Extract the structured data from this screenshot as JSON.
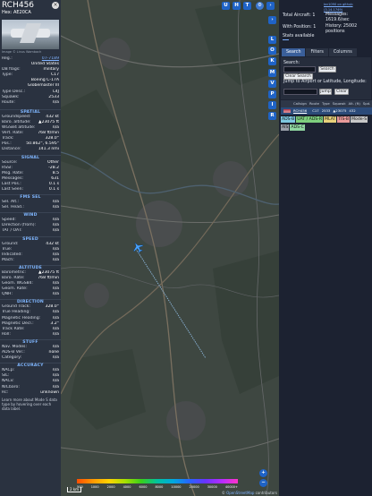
{
  "aircraft": {
    "callsign": "RCH456",
    "hex_label": "Hex: AE20CA",
    "photo_credit": "Image © Linus Wambach",
    "reg": {
      "label": "Reg.:",
      "value": "07-7189"
    },
    "country": {
      "label": "",
      "value": "United States"
    },
    "db_flags": {
      "label": "DB flags:",
      "value": "military"
    },
    "type": {
      "label": "Type:",
      "value": "C17"
    },
    "type_name_1": {
      "label": "",
      "value": "Boeing C-17A"
    },
    "type_name_2": {
      "label": "",
      "value": "Globemaster III"
    },
    "type_desc": {
      "label": "Type Desc.:",
      "value": "L4J"
    },
    "squawk": {
      "label": "Squawk:",
      "value": "2533"
    },
    "route": {
      "label": "Route:",
      "value": "n/a"
    }
  },
  "sections": {
    "spatial": {
      "title": "SPATIAL",
      "rows": [
        {
          "label": "Groundspeed:",
          "value": "432 kt"
        },
        {
          "label": "Baro. altitude:",
          "value": "▲23075 ft"
        },
        {
          "label": "WGS84 altitude:",
          "value": "n/a"
        },
        {
          "label": "Vert. Rate:",
          "value": "768 ft/min"
        },
        {
          "label": "Track:",
          "value": "328.0°"
        },
        {
          "label": "Pos.:",
          "value": "50.862°, 6.595°"
        },
        {
          "label": "Distance:",
          "value": "141.3 nmi"
        }
      ]
    },
    "signal": {
      "title": "SIGNAL",
      "rows": [
        {
          "label": "Source:",
          "value": "Other"
        },
        {
          "label": "RSSI:",
          "value": "-28.2"
        },
        {
          "label": "Msg. Rate:",
          "value": "8.5"
        },
        {
          "label": "Messages:",
          "value": "631"
        },
        {
          "label": "Last Pos.:",
          "value": "0.1 s"
        },
        {
          "label": "Last Seen:",
          "value": "0.1 s"
        }
      ]
    },
    "fms": {
      "title": "FMS SEL",
      "rows": [
        {
          "label": "Sel. Alt.:",
          "value": "n/a"
        },
        {
          "label": "Sel. Head.:",
          "value": "n/a"
        }
      ]
    },
    "wind": {
      "title": "WIND",
      "rows": [
        {
          "label": "Speed:",
          "value": "n/a"
        },
        {
          "label": "Direction (from):",
          "value": "n/a"
        },
        {
          "label": "TAT / OAT:",
          "value": "n/a"
        }
      ]
    },
    "speed": {
      "title": "SPEED",
      "rows": [
        {
          "label": "Ground:",
          "value": "432 kt"
        },
        {
          "label": "True:",
          "value": "n/a"
        },
        {
          "label": "Indicated:",
          "value": "n/a"
        },
        {
          "label": "Mach:",
          "value": "n/a"
        }
      ]
    },
    "altitude": {
      "title": "ALTITUDE",
      "rows": [
        {
          "label": "Barometric:",
          "value": "▲23075 ft"
        },
        {
          "label": "Baro. Rate:",
          "value": "768 ft/min"
        },
        {
          "label": "Geom. WGS84:",
          "value": "n/a"
        },
        {
          "label": "Geom. Rate:",
          "value": "n/a"
        },
        {
          "label": "QNH:",
          "value": "n/a"
        }
      ]
    },
    "direction": {
      "title": "DIRECTION",
      "rows": [
        {
          "label": "Ground Track:",
          "value": "328.0°"
        },
        {
          "label": "True Heading:",
          "value": "n/a"
        },
        {
          "label": "Magnetic Heading:",
          "value": "n/a"
        },
        {
          "label": "Magnetic Decl.:",
          "value": "3.2°"
        },
        {
          "label": "Track Rate:",
          "value": "n/a"
        },
        {
          "label": "Roll:",
          "value": "n/a"
        }
      ]
    },
    "stuff": {
      "title": "STUFF",
      "rows": [
        {
          "label": "Nav. Modes:",
          "value": "n/a"
        },
        {
          "label": "ADS-B Ver.:",
          "value": "none"
        },
        {
          "label": "Category:",
          "value": "n/a"
        }
      ]
    },
    "accuracy": {
      "title": "ACCURACY",
      "rows": [
        {
          "label": "NACp:",
          "value": "n/a"
        },
        {
          "label": "SIL:",
          "value": "n/a"
        },
        {
          "label": "NACv:",
          "value": "n/a"
        },
        {
          "label": "NICbaro:",
          "value": "n/a"
        },
        {
          "label": "Rc:",
          "value": "unknown"
        }
      ]
    }
  },
  "footer_text": "Learn more about Mode S data type by hovering over each data label.",
  "map": {
    "top_buttons": [
      "U",
      "H",
      "T"
    ],
    "side_buttons": [
      "L",
      "O",
      "K",
      "M",
      "V",
      "P",
      "I",
      "R"
    ],
    "scale_label": "2 km",
    "credit_prefix": "© ",
    "credit_link": "OpenStreetMap",
    "credit_suffix": " contributors",
    "colorbar_ticks": [
      "500",
      "1000",
      "2000",
      "4000",
      "6000",
      "8000",
      "10000",
      "20000",
      "30000",
      "40000+"
    ],
    "zoom_in": "+",
    "zoom_out": "−"
  },
  "right": {
    "version": "tar1090 on github (3.14.1749)",
    "total_aircraft": "Total Aircraft: 1",
    "with_position": "With Position: 1",
    "stats_available": "Stats available",
    "messages": "Messages: 1619.6/sec",
    "history": "History: 25002 positions",
    "tabs": [
      "Search",
      "Filters",
      "Columns"
    ],
    "search_label": "Search:",
    "search_button": "Search",
    "clear_search": "Clear Search",
    "jump_label": "Jump to Airport or Latitude, Longitude:",
    "jump_button": "Jump",
    "clear_button": "Clear",
    "table_headers": [
      "",
      "Callsign",
      "Route",
      "Type",
      "Squawk",
      "Alt. (ft)",
      "Spd."
    ],
    "table_row": [
      "",
      "RCH456",
      "",
      "C17",
      "2533",
      "▲23075",
      "432"
    ],
    "legend": [
      {
        "label": "ADS-B",
        "color": "#7ec8e0"
      },
      {
        "label": "UAT / ADS-R",
        "color": "#7ed07e"
      },
      {
        "label": "MLAT",
        "color": "#e8d27a"
      },
      {
        "label": "TIS-B",
        "color": "#e89a9a"
      },
      {
        "label": "Mode-S",
        "color": "#c8c8c8"
      },
      {
        "label": "AIS",
        "color": "#9aa0aa"
      },
      {
        "label": "ADS-C",
        "color": "#8fd6a0"
      }
    ]
  }
}
